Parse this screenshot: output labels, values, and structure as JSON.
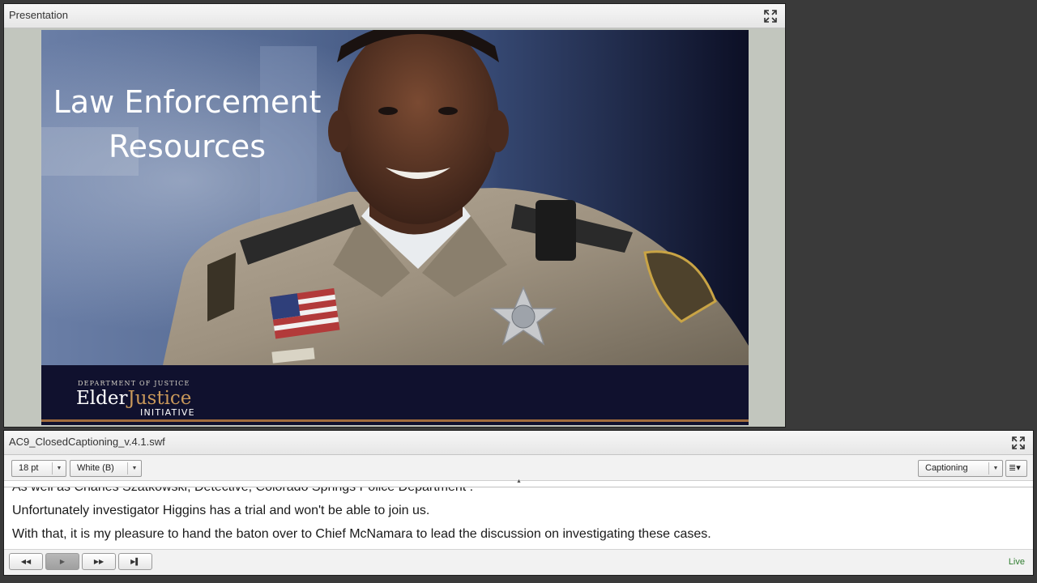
{
  "presentation_pod": {
    "title": "Presentation",
    "maximize_icon": "maximize-arrows-icon",
    "slide": {
      "title": "Law Enforcement\nResources",
      "logo": {
        "department": "DEPARTMENT OF JUSTICE",
        "elder": "Elder",
        "justice": "Justice",
        "initiative": "INITIATIVE"
      }
    }
  },
  "captioning_pod": {
    "title": "AC9_ClosedCaptioning_v.4.1.swf",
    "maximize_icon": "maximize-arrows-icon",
    "font_size": "18 pt",
    "text_color": "White (B)",
    "mode": "Captioning",
    "menu_icon": "list-menu-icon",
    "captions": [
      "As well as Charles Szatkowski, Detective, Colorado Springs Police Department .",
      "Unfortunately investigator Higgins has a trial and won't be able to join us.",
      "With that, it is my pleasure to hand the baton over to Chief McNamara to lead the discussion on investigating these cases."
    ],
    "playback": {
      "rewind_icon": "rewind-icon",
      "play_icon": "play-icon",
      "fast_forward_icon": "fast-forward-icon",
      "skip_end_icon": "skip-to-end-icon"
    },
    "status": "Live"
  },
  "colors": {
    "background": "#3a3a3a",
    "slide_band": "#10112e",
    "logo_accent": "#c9985a",
    "live_status": "#2f7d2f"
  }
}
